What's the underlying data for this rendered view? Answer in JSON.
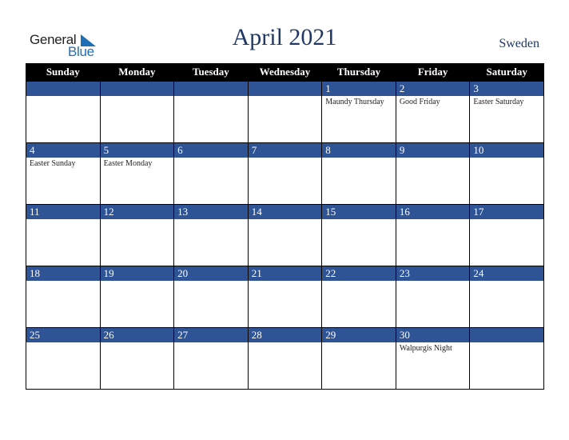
{
  "logo": {
    "word1": "General",
    "word2": "Blue"
  },
  "header": {
    "title": "April 2021",
    "country": "Sweden"
  },
  "colors": {
    "header_bg": "#000000",
    "day_bar": "#2f5496",
    "title": "#1f3864",
    "logo_blue": "#1f6fb5"
  },
  "weekdays": [
    "Sunday",
    "Monday",
    "Tuesday",
    "Wednesday",
    "Thursday",
    "Friday",
    "Saturday"
  ],
  "weeks": [
    [
      {
        "day": "",
        "holiday": ""
      },
      {
        "day": "",
        "holiday": ""
      },
      {
        "day": "",
        "holiday": ""
      },
      {
        "day": "",
        "holiday": ""
      },
      {
        "day": "1",
        "holiday": "Maundy Thursday"
      },
      {
        "day": "2",
        "holiday": "Good Friday"
      },
      {
        "day": "3",
        "holiday": "Easter Saturday"
      }
    ],
    [
      {
        "day": "4",
        "holiday": "Easter Sunday"
      },
      {
        "day": "5",
        "holiday": "Easter Monday"
      },
      {
        "day": "6",
        "holiday": ""
      },
      {
        "day": "7",
        "holiday": ""
      },
      {
        "day": "8",
        "holiday": ""
      },
      {
        "day": "9",
        "holiday": ""
      },
      {
        "day": "10",
        "holiday": ""
      }
    ],
    [
      {
        "day": "11",
        "holiday": ""
      },
      {
        "day": "12",
        "holiday": ""
      },
      {
        "day": "13",
        "holiday": ""
      },
      {
        "day": "14",
        "holiday": ""
      },
      {
        "day": "15",
        "holiday": ""
      },
      {
        "day": "16",
        "holiday": ""
      },
      {
        "day": "17",
        "holiday": ""
      }
    ],
    [
      {
        "day": "18",
        "holiday": ""
      },
      {
        "day": "19",
        "holiday": ""
      },
      {
        "day": "20",
        "holiday": ""
      },
      {
        "day": "21",
        "holiday": ""
      },
      {
        "day": "22",
        "holiday": ""
      },
      {
        "day": "23",
        "holiday": ""
      },
      {
        "day": "24",
        "holiday": ""
      }
    ],
    [
      {
        "day": "25",
        "holiday": ""
      },
      {
        "day": "26",
        "holiday": ""
      },
      {
        "day": "27",
        "holiday": ""
      },
      {
        "day": "28",
        "holiday": ""
      },
      {
        "day": "29",
        "holiday": ""
      },
      {
        "day": "30",
        "holiday": "Walpurgis Night"
      },
      {
        "day": "",
        "holiday": ""
      }
    ]
  ]
}
